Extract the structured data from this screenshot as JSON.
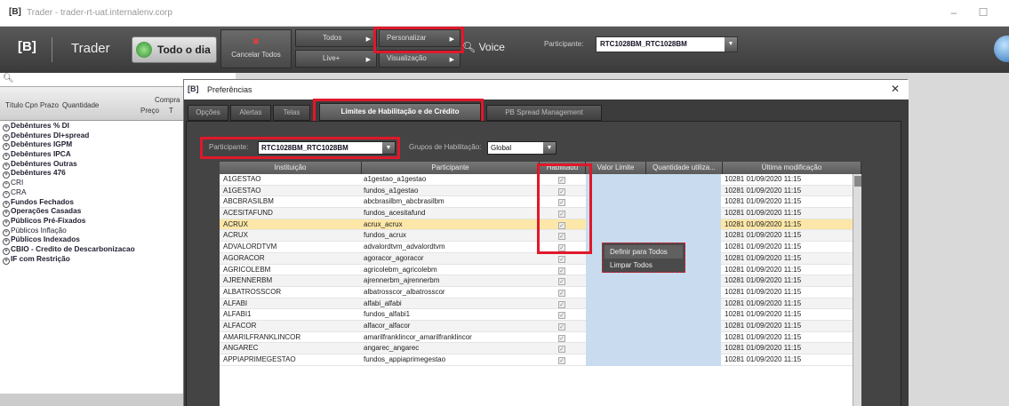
{
  "os": {
    "logo": "[B]",
    "title": "Trader - trader-rt-uat.internalenv.corp",
    "minimize": "–",
    "maximize": "☐"
  },
  "toolbar": {
    "brand": "[B]",
    "app_name": "Trader",
    "day_button": "Todo o dia",
    "cancel_all": "Cancelar Todos",
    "todos": "Todos",
    "live": "Live+",
    "personalizar": "Personalizar",
    "visualizacao": "Visualização",
    "voice": "Voice",
    "participant_label": "Participante:",
    "participant_value": "RTC1028BM_RTC1028BM"
  },
  "left_panel": {
    "search_placeholder": "",
    "columns": {
      "titulo": "Título",
      "cpn": "Cpn",
      "prazo": "Prazo",
      "quantidade": "Quantidade",
      "compra": "Compra",
      "preco": "Preço",
      "t": "T"
    },
    "categories": [
      {
        "label": "Debêntures % DI",
        "bold": true
      },
      {
        "label": "Debêntures DI+spread",
        "bold": true
      },
      {
        "label": "Debêntures IGPM",
        "bold": true
      },
      {
        "label": "Debêntures IPCA",
        "bold": true
      },
      {
        "label": "Debêntures Outras",
        "bold": true
      },
      {
        "label": "Debêntures 476",
        "bold": true
      },
      {
        "label": "CRI",
        "bold": false
      },
      {
        "label": "CRA",
        "bold": false
      },
      {
        "label": "Fundos Fechados",
        "bold": true
      },
      {
        "label": "Operações Casadas",
        "bold": true
      },
      {
        "label": "Públicos Pré-Fixados",
        "bold": true
      },
      {
        "label": "Públicos Inflação",
        "bold": false
      },
      {
        "label": "Públicos Indexados",
        "bold": true
      },
      {
        "label": "CBIO - Credito de Descarbonizacao",
        "bold": true
      },
      {
        "label": "IF com Restrição",
        "bold": true
      }
    ]
  },
  "dialog": {
    "logo": "[B]",
    "title": "Preferências",
    "close": "✕",
    "tabs": [
      "Opções",
      "Alertas",
      "Telas",
      "Limites de Habilitação e de Crédito",
      "PB Spread Management"
    ],
    "active_tab": 3,
    "participant_label": "Participante:",
    "participant_value": "RTC1028BM_RTC1028BM",
    "group_label": "Grupos de Habilitação:",
    "group_value": "Global",
    "grid": {
      "columns": [
        "Instituição",
        "Participante",
        "Habilitado",
        "Valor Limite",
        "Quantidade utiliza...",
        "Última modificação"
      ],
      "rows": [
        {
          "inst": "A1GESTAO",
          "part": "a1gestao_a1gestao",
          "hab": "✓",
          "ult": "10281  01/09/2020 11:15"
        },
        {
          "inst": "A1GESTAO",
          "part": "fundos_a1gestao",
          "hab": "✓",
          "ult": "10281  01/09/2020 11:15"
        },
        {
          "inst": "ABCBRASILBM",
          "part": "abcbrasilbm_abcbrasilbm",
          "hab": "✓",
          "ult": "10281  01/09/2020 11:15"
        },
        {
          "inst": "ACESITAFUND",
          "part": "fundos_acesitafund",
          "hab": "✓",
          "ult": "10281  01/09/2020 11:15"
        },
        {
          "inst": "ACRUX",
          "part": "acrux_acrux",
          "hab": "✓",
          "ult": "10281  01/09/2020 11:15",
          "selected": true
        },
        {
          "inst": "ACRUX",
          "part": "fundos_acrux",
          "hab": "✓",
          "ult": "10281  01/09/2020 11:15"
        },
        {
          "inst": "ADVALORDTVM",
          "part": "advalordtvm_advalordtvm",
          "hab": "✓",
          "ult": "10281  01/09/2020 11:15"
        },
        {
          "inst": "AGORACOR",
          "part": "agoracor_agoracor",
          "hab": "✓",
          "ult": "10281  01/09/2020 11:15"
        },
        {
          "inst": "AGRICOLEBM",
          "part": "agricolebm_agricolebm",
          "hab": "✓",
          "ult": "10281  01/09/2020 11:15"
        },
        {
          "inst": "AJRENNERBM",
          "part": "ajrennerbm_ajrennerbm",
          "hab": "✓",
          "ult": "10281  01/09/2020 11:15"
        },
        {
          "inst": "ALBATROSSCOR",
          "part": "albatrosscor_albatrosscor",
          "hab": "✓",
          "ult": "10281  01/09/2020 11:15"
        },
        {
          "inst": "ALFABI",
          "part": "alfabi_alfabi",
          "hab": "✓",
          "ult": "10281  01/09/2020 11:15"
        },
        {
          "inst": "ALFABI1",
          "part": "fundos_alfabi1",
          "hab": "✓",
          "ult": "10281  01/09/2020 11:15"
        },
        {
          "inst": "ALFACOR",
          "part": "alfacor_alfacor",
          "hab": "✓",
          "ult": "10281  01/09/2020 11:15"
        },
        {
          "inst": "AMARILFRANKLINCOR",
          "part": "amarilfranklincor_amarilfranklincor",
          "hab": "✓",
          "ult": "10281  01/09/2020 11:15"
        },
        {
          "inst": "ANGAREC",
          "part": "angarec_angarec",
          "hab": "✓",
          "ult": "10281  01/09/2020 11:15"
        },
        {
          "inst": "APPIAPRIMEGESTAO",
          "part": "fundos_appiaprimegestao",
          "hab": "✓",
          "ult": "10281  01/09/2020 11:15"
        }
      ]
    },
    "context_menu": [
      "Definir para Todos",
      "Limpar Todos"
    ]
  },
  "colors": {
    "highlight_red": "#e0182a",
    "selected_row": "#fde7a8",
    "editable_cell": "#c9dcef"
  }
}
